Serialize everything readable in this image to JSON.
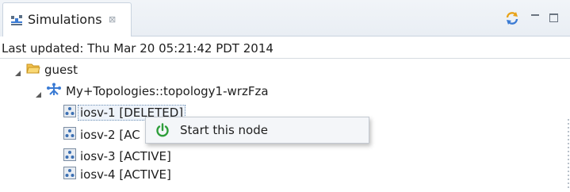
{
  "tab": {
    "title": "Simulations",
    "close_glyph": "⊠",
    "icon": "simulations-icon"
  },
  "toolbar": {
    "sync_icon": "sync-icon",
    "minimize_icon": "minimize-icon",
    "maximize_icon": "maximize-icon"
  },
  "status": {
    "last_updated": "Last updated: Thu Mar 20 05:21:42 PDT 2014"
  },
  "tree": {
    "user": {
      "label": "guest",
      "icon": "folder-icon"
    },
    "topology": {
      "label": "My+Topologies::topology1-wrzFza",
      "icon": "topology-icon"
    },
    "nodes": [
      {
        "label": "iosv-1 [DELETED]",
        "visible_label": "iosv-1 [DELETED]"
      },
      {
        "label": "iosv-2 [AC"
      },
      {
        "label": "iosv-3 [ACTIVE]"
      },
      {
        "label": "iosv-4 [ACTIVE]"
      }
    ]
  },
  "context_menu": {
    "items": [
      {
        "label": "Start this node",
        "icon": "power-icon"
      }
    ]
  },
  "colors": {
    "accent": "#3b7bd4",
    "power_green": "#2e9e3a",
    "folder": "#e8b43a"
  }
}
